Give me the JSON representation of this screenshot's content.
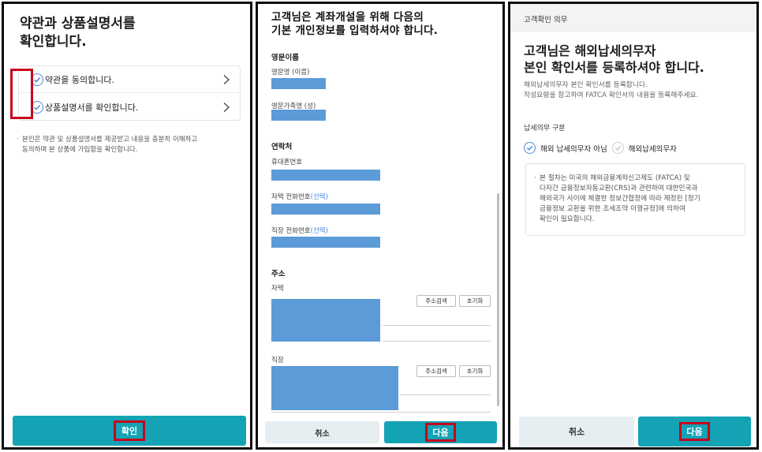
{
  "panel1": {
    "title_line1": "약관과 상품설명서를",
    "title_line2": "확인합니다.",
    "items": [
      {
        "label": "약관을 동의합니다."
      },
      {
        "label": "상품설명서를 확인합니다."
      }
    ],
    "note_line1": "본인은 약관 및 상품설명서를 제공받고 내용을 충분히 이해하고",
    "note_line2": "동의하며 본 상품에 가입함을 확인합니다.",
    "confirm_label": "확인"
  },
  "panel2": {
    "title_line1": "고객님은 계좌개설을 위해 다음의",
    "title_line2": "기본 개인정보를 입력하셔야 합니다.",
    "section_english_name": "영문이름",
    "label_first_name": "영문명 (이름)",
    "label_last_name": "영문가족명 (성)",
    "section_contact": "연락처",
    "label_mobile": "휴대폰번호",
    "label_home_phone": "자택 전화번호",
    "label_work_phone": "직장 전화번호",
    "optional_text": "(선택)",
    "section_address": "주소",
    "label_home": "자택",
    "label_work": "직장",
    "address_search_label": "주소검색",
    "reset_label": "초기화",
    "cancel_label": "취소",
    "next_label": "다음"
  },
  "panel3": {
    "top_title": "고객확인 의무",
    "title_line1": "고객님은 해외납세의무자",
    "title_line2": "본인 확인서를 등록하셔야 합니다.",
    "desc_line1": "해외납세의무자 본인 확인서를 등록합니다.",
    "desc_line2": "작성요령을 참고하여 FATCA 확인서의 내용을 등록해주세요.",
    "sub_label": "납세의무 구분",
    "option_not_taxpayer": "해외 납세의무자 아님",
    "option_taxpayer": "해외납세의무자",
    "info_line1": "본 절차는 미국의 해외금융계좌신고제도 (FATCA) 및",
    "info_line2": "다자간 금융정보자동교환(CRS)과 관련하여 대한민국과",
    "info_line3": "해외국가 사이에 체결한 정보간협정에 따라 제정된 [정기",
    "info_line4": "금융정보 교환을 위한 조세조약 이행규정]에 의하여",
    "info_line5": "확인이 필요합니다.",
    "cancel_label": "취소",
    "next_label": "다음"
  },
  "colors": {
    "accent": "#13a3b5",
    "check_blue": "#4b8ad8",
    "fill_blue": "#5c9bd8",
    "highlight_red": "#c8001c"
  }
}
